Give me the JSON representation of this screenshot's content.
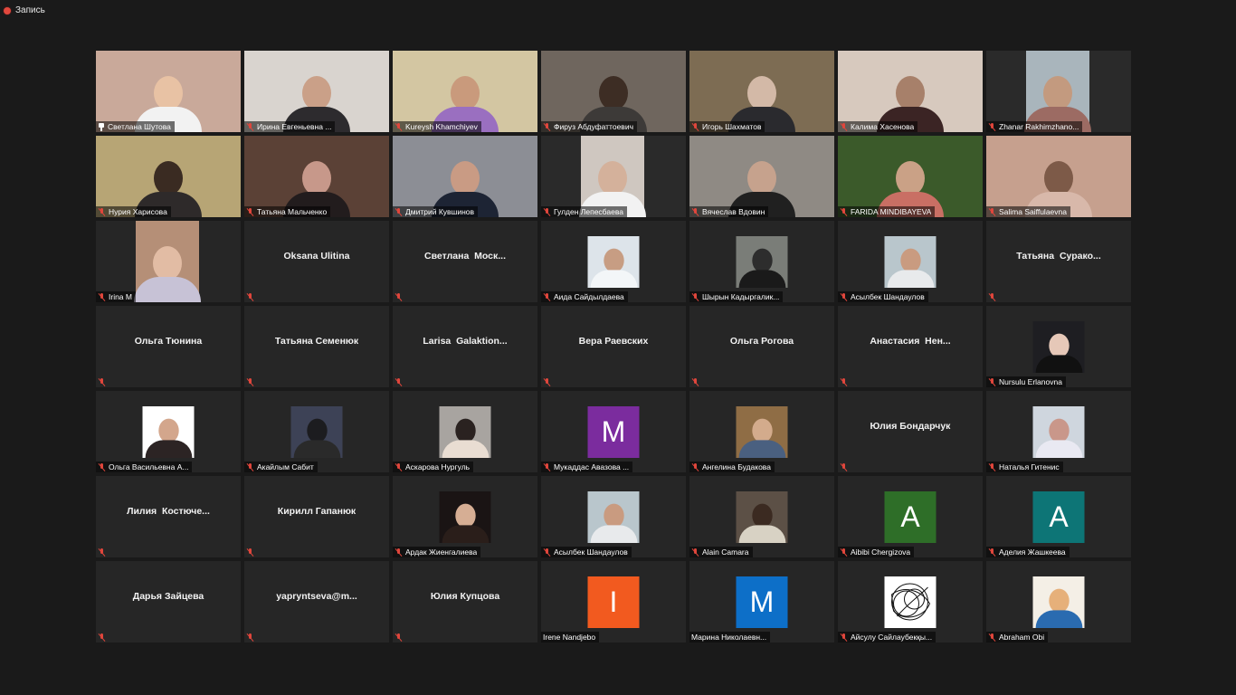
{
  "recording": {
    "label": "Запись",
    "color": "#e2483d"
  },
  "accent_active": "#c8d24a",
  "participants": [
    {
      "name": "Светлана Шутова",
      "mode": "video",
      "bg": "#c9a99a",
      "head": "#e8c2a4",
      "body": "#f2f2f2",
      "pinned": true
    },
    {
      "name": "Ирина Евгеньевна ...",
      "mode": "video",
      "bg": "#d9d4cf",
      "head": "#caa088",
      "body": "#2d2b2e"
    },
    {
      "name": "Kureysh Khamchiyev",
      "mode": "video",
      "bg": "#d3c6a2",
      "head": "#c99a7c",
      "body": "#9a6fc0"
    },
    {
      "name": "Фируз Абдуфаттоевич",
      "mode": "video",
      "bg": "#6f665e",
      "head": "#3d2d24",
      "body": "#3d3a38"
    },
    {
      "name": "Игорь Шахматов",
      "mode": "video",
      "bg": "#7d6c53",
      "head": "#d3b9a7",
      "body": "#2a2a2e"
    },
    {
      "name": "Калима Хасенова",
      "mode": "video",
      "bg": "#d7c9be",
      "head": "#a7806a",
      "body": "#3b2424"
    },
    {
      "name": "Zhanar Rakhimzhano...",
      "mode": "video",
      "bg": "#2a2a2a",
      "head": "#c39a7f",
      "body": "#9c6b63",
      "narrow": true,
      "narrow_bg": "#a9b5bc"
    },
    {
      "name": "Нурия Харисова",
      "mode": "video",
      "bg": "#b7a575",
      "head": "#3a2b22",
      "body": "#2e2a2a"
    },
    {
      "name": "Татьяна Мальченко",
      "mode": "video",
      "bg": "#5b4136",
      "head": "#c7988a",
      "body": "#221c1d"
    },
    {
      "name": "Дмитрий Кувшинов",
      "mode": "video",
      "bg": "#8c8e95",
      "head": "#c99b84",
      "body": "#1d2434",
      "active": true
    },
    {
      "name": "Гулден Лепесбаева",
      "mode": "video",
      "bg": "#2a2a2a",
      "head": "#d4b19b",
      "body": "#f2f2f2",
      "narrow": true,
      "narrow_bg": "#cfc7c0"
    },
    {
      "name": "Вячеслав Вдовин",
      "mode": "video",
      "bg": "#8f8a84",
      "head": "#c6a28d",
      "body": "#202020"
    },
    {
      "name": "FARIDA MINDIBAYEVA",
      "mode": "video",
      "bg": "#3b5a2a",
      "head": "#caa186",
      "body": "#c96f64"
    },
    {
      "name": "Salima Saiffulaevna",
      "mode": "video",
      "bg": "#c6a08e",
      "head": "#7d5a48",
      "body": "#d8b8aa"
    },
    {
      "name": "Irina M",
      "mode": "video",
      "bg": "#262626",
      "head": "#e2bca4",
      "body": "#c7c2d6",
      "narrow": true,
      "narrow_bg": "#b58f77"
    },
    {
      "name": "Oksana Ulitina",
      "mode": "name"
    },
    {
      "name": "Светлана  Моск...",
      "mode": "name"
    },
    {
      "name": "Аида Сайдылдаева",
      "mode": "avatar",
      "avatar_bg": "#dde4ea",
      "head": "#c79d83",
      "body": "#f3f6f8"
    },
    {
      "name": "Шырын Кадыргалик...",
      "mode": "avatar",
      "avatar_bg": "#7a7d78",
      "head": "#2d2d2d",
      "body": "#1a1a1a"
    },
    {
      "name": "Асылбек Шандаулов",
      "mode": "avatar",
      "avatar_bg": "#b9c6cc",
      "head": "#c99b80",
      "body": "#e8eaec"
    },
    {
      "name": "Татьяна  Сурако...",
      "mode": "name"
    },
    {
      "name": "Ольга Тюнина",
      "mode": "name"
    },
    {
      "name": "Татьяна Семенюк",
      "mode": "name"
    },
    {
      "name": "Larisa  Galaktion...",
      "mode": "name"
    },
    {
      "name": "Вера Раевских",
      "mode": "name"
    },
    {
      "name": "Ольга Рогова",
      "mode": "name"
    },
    {
      "name": "Анастасия  Нен...",
      "mode": "name"
    },
    {
      "name": "Nursulu Erlanovna",
      "mode": "avatar",
      "avatar_bg": "#1e1e22",
      "head": "#e6c8b8",
      "body": "#111111"
    },
    {
      "name": "Ольга Васильевна А...",
      "mode": "avatar",
      "avatar_bg": "#ffffff",
      "head": "#d3a68c",
      "body": "#2c2424"
    },
    {
      "name": "Акайлым Сабит",
      "mode": "avatar",
      "avatar_bg": "#3d4256",
      "head": "#1c1c1f",
      "body": "#2a2a2a"
    },
    {
      "name": "Аскарова Нургуль",
      "mode": "avatar",
      "avatar_bg": "#a8a4a0",
      "head": "#2a2220",
      "body": "#e9ddd2"
    },
    {
      "name": "Мукаддас Авазова ...",
      "mode": "letter",
      "letter": "M",
      "color": "#7b2c9e"
    },
    {
      "name": "Ангелина Будакова",
      "mode": "avatar",
      "avatar_bg": "#8f6d45",
      "head": "#d3ab8c",
      "body": "#4a6080"
    },
    {
      "name": "Юлия Бондарчук",
      "mode": "name"
    },
    {
      "name": "Наталья Гитенис",
      "mode": "avatar",
      "avatar_bg": "#cfd6de",
      "head": "#c9978a",
      "body": "#e9e9f2"
    },
    {
      "name": "Лилия  Костюче...",
      "mode": "name"
    },
    {
      "name": "Кирилл Гапанюк",
      "mode": "name"
    },
    {
      "name": "Ардак Жиенгалиева",
      "mode": "avatar",
      "avatar_bg": "#1a1414",
      "head": "#d6ae94",
      "body": "#2a1e1a"
    },
    {
      "name": "Асылбек Шандаулов",
      "mode": "avatar",
      "avatar_bg": "#b9c6cc",
      "head": "#c99b80",
      "body": "#e8eaec"
    },
    {
      "name": "Alain Camara",
      "mode": "avatar",
      "avatar_bg": "#5c5046",
      "head": "#3b2a21",
      "body": "#d8d2c4"
    },
    {
      "name": "Aibibi Chergizova",
      "mode": "letter",
      "letter": "A",
      "color": "#2e6e28"
    },
    {
      "name": "Аделия Жашкеева",
      "mode": "letter",
      "letter": "A",
      "color": "#0d7576"
    },
    {
      "name": "Дарья Зайцева",
      "mode": "name"
    },
    {
      "name": "yapryntseva@m...",
      "mode": "name"
    },
    {
      "name": "Юлия Купцова",
      "mode": "name"
    },
    {
      "name": "Irene Nandjebo",
      "mode": "letter",
      "letter": "I",
      "color": "#f25a1f",
      "no_mic": true
    },
    {
      "name": "Марина Николаевн...",
      "mode": "letter",
      "letter": "M",
      "color": "#0d6fc8",
      "no_mic": true
    },
    {
      "name": "Айсулу Сайлаубекқы...",
      "mode": "avatar",
      "avatar_bg": "#ffffff",
      "head": "#ffffff",
      "body": "#ffffff",
      "scribble": true
    },
    {
      "name": "Abraham Obi",
      "mode": "avatar",
      "avatar_bg": "#f4efe6",
      "head": "#e6b07a",
      "body": "#2a6bb0"
    }
  ]
}
